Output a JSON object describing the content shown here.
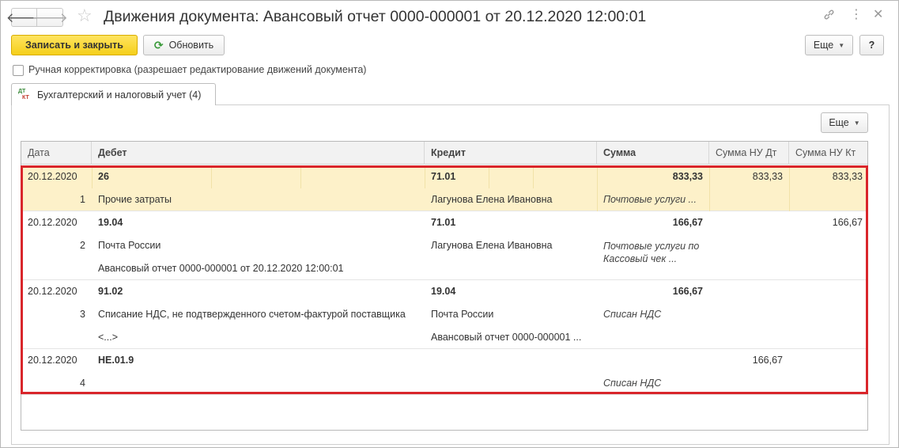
{
  "window": {
    "title": "Движения документа: Авансовый отчет 0000-000001 от 20.12.2020 12:00:01",
    "icons": {
      "back": "arrow-left-icon",
      "forward": "arrow-right-icon",
      "favorite": "star-icon",
      "link": "link-icon",
      "more": "more-vertical-icon",
      "close": "close-icon"
    }
  },
  "toolbar": {
    "save_close_label": "Записать и закрыть",
    "refresh_label": "Обновить",
    "more_label": "Еще",
    "help_label": "?"
  },
  "manual_correction": {
    "label": "Ручная корректировка (разрешает редактирование движений документа)",
    "checked": false
  },
  "tab": {
    "label": "Бухгалтерский и налоговый учет (4)",
    "icon": "dt-kt-icon"
  },
  "grid": {
    "more_label": "Еще",
    "columns": [
      "Дата",
      "Дебет",
      "Кредит",
      "Сумма",
      "Сумма НУ Дт",
      "Сумма НУ Кт"
    ],
    "rows": [
      {
        "date": "20.12.2020",
        "num": "1",
        "debit": "26",
        "debit_sub1": "Прочие затраты",
        "debit_sub2": "",
        "credit": "71.01",
        "credit_sub1": "Лагунова Елена Ивановна",
        "credit_sub2": "",
        "sum": "833,33",
        "content": "Почтовые услуги ...",
        "nu_dt": "833,33",
        "nu_kt": "833,33"
      },
      {
        "date": "20.12.2020",
        "num": "2",
        "debit": "19.04",
        "debit_sub1": "Почта России",
        "debit_sub2": "Авансовый отчет 0000-000001 от 20.12.2020 12:00:01",
        "credit": "71.01",
        "credit_sub1": "Лагунова Елена Ивановна",
        "credit_sub2": "",
        "sum": "166,67",
        "content": "Почтовые услуги по Кассовый чек ...",
        "nu_dt": "",
        "nu_kt": "166,67"
      },
      {
        "date": "20.12.2020",
        "num": "3",
        "debit": "91.02",
        "debit_sub1": "Списание НДС, не подтвержденного счетом-фактурой поставщика",
        "debit_sub2": "<...>",
        "credit": "19.04",
        "credit_sub1": "Почта России",
        "credit_sub2": "Авансовый отчет 0000-000001 ...",
        "sum": "166,67",
        "content": "Списан НДС",
        "nu_dt": "",
        "nu_kt": ""
      },
      {
        "date": "20.12.2020",
        "num": "4",
        "debit": "НЕ.01.9",
        "debit_sub1": "",
        "debit_sub2": "",
        "credit": "",
        "credit_sub1": "",
        "credit_sub2": "",
        "sum": "",
        "content": "Списан НДС",
        "nu_dt": "166,67",
        "nu_kt": ""
      }
    ]
  },
  "colors": {
    "primary_button": "#f5cf1a",
    "selected_row": "#fdf1c9",
    "highlight_frame": "#d9262b"
  }
}
